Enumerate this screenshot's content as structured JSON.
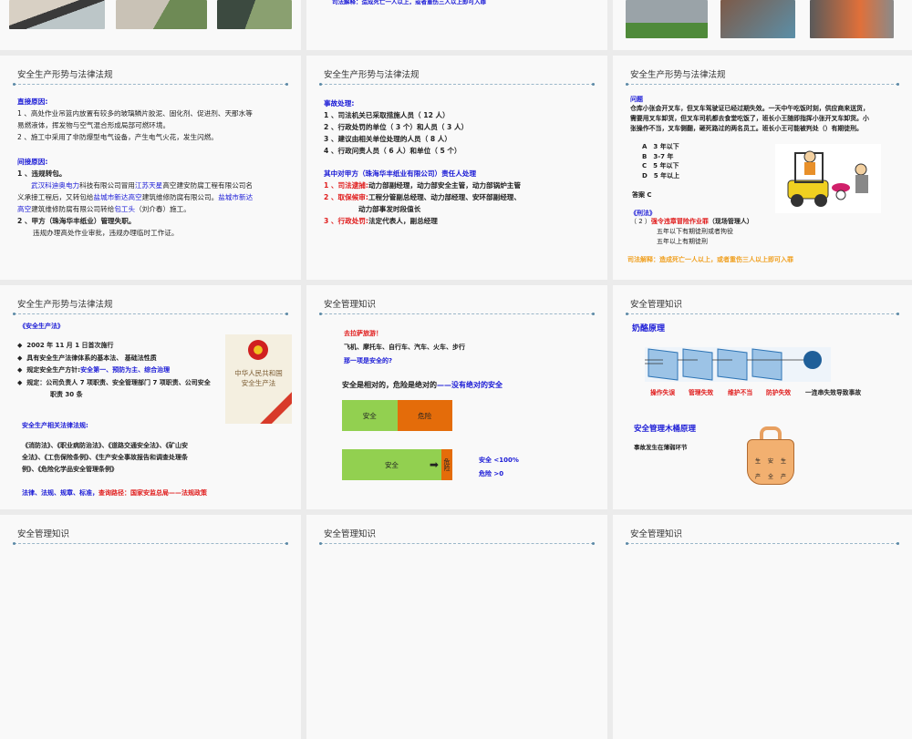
{
  "slide_title_law": "安全生产形势与法律法规",
  "slide_title_mgmt": "安全管理知识",
  "top_row": {
    "middle_text": "司法解释：造成死亡一人以上，或者重伤三人以上即可入罪"
  },
  "slide_direct": {
    "h1": "直接原因:",
    "l1": "1 、高处作业吊篮内放置有较多的玻璃鳞片胶泥、固化剂、促进剂、天那水等",
    "l2": "易燃液体，挥发物与空气混合形成局部可燃环境。",
    "l3": "2 、施工中采用了非防爆型电气设备，产生电气火花，发生闪燃。",
    "h2": "间接原因:",
    "p1": "1 、违规转包。",
    "p1a": [
      "武汉科迪奥电力",
      "科技有限公司冒用",
      "江苏天星",
      "高空建安防腐工程有限公司名"
    ],
    "p1b": [
      "义承接工程后，又转包给",
      "盐城市新达高空",
      "建筑维修防腐有限公司。",
      "盐城市新达"
    ],
    "p1c": [
      "高空",
      "建筑维修防腐有限公司转给",
      "包工头",
      "（刘介春）施工。"
    ],
    "p2": "2 、甲方（珠海华丰纸业）管理失职。",
    "p2a": "违规办理高处作业审批，违规办理临时工作证。"
  },
  "slide_handling": {
    "h1": "事故处理:",
    "items": [
      "1 、司法机关已采取措施人员（ 12 人）",
      "2 、行政处罚的单位（ 3 个）和人员（ 3 人）",
      "3 、建议由相关单位处理的人员（ 8 人）",
      "4 、行政问责人员（ 6 人）和单位（ 5 个）"
    ],
    "h2": "其中对甲方（珠海华丰纸业有限公司）责任人处理",
    "r1": {
      "label": "1 、司法逮捕:",
      "text": "动力部副经理，动力部安全主管，动力部锅炉主管"
    },
    "r2": {
      "label": "2 、取保候审:",
      "text": "工程分管副总经理、动力部经理、安环部副经理、",
      "text2": "动力部事发时段值长"
    },
    "r3": {
      "label": "3 、行政处罚:",
      "text": "法定代表人，副总经理"
    }
  },
  "slide_question": {
    "h": "问题",
    "q": [
      "仓库小张会开叉车，但叉车驾驶证已经过期失效。一天中午吃饭时刻，供应商来送货，",
      "需要用叉车卸货，但叉车司机都去食堂吃饭了，班长小王随即指挥小张开叉车卸货。小",
      "张操作不当，叉车侧翻，砸死路过的两名员工。班长小王可能被判处（）有期徒刑。"
    ],
    "options": [
      "A　3 年以下",
      "B　3-7 年",
      "C　5 年以下",
      "D　5 年以上"
    ],
    "answer": "答案 C",
    "law": "《刑法》",
    "crime_prefix": "（ 2 ）",
    "crime": "强令违章冒险作业罪",
    "crime_suffix": "（现场管理人）",
    "s1": "五年以下有期徒刑或者拘役",
    "s2": "五年以上有期徒刑",
    "note": "司法解释：造成死亡一人以上，或者重伤三人以上即可入罪"
  },
  "slide_safety_law": {
    "h": "《安全生产法》",
    "bullets": [
      "2002 年 11 月 1 日首次施行",
      "具有安全生产法律体系的基本法、 基础法性质"
    ],
    "b3_label": "规定安全生产方针:",
    "b3_blue": "安全第一、预防为主、综合治理",
    "b4": "规定：公司负责人 7 项职责、安全管理部门 7 项职责、公司安全",
    "b4b": "职责 30 条",
    "book_title_1": "中华人民共和国",
    "book_title_2": "安全生产法",
    "h2": "安全生产相关法律法规:",
    "laws": [
      "《消防法》、《职业病防治法》、《道路交通安全法》、《矿山安",
      "全法》、《工伤保险条例》、《生产安全事故报告和调查处理条",
      "例》、《危险化学品安全管理条例》"
    ],
    "footer_blue": "法律、法规、规章、标准，",
    "footer_red": "查询路径：国家安监总局——法规政策"
  },
  "slide_relative": {
    "l1": "去拉萨旅游！",
    "l2": "飞机、摩托车、自行车、汽车、火车、步行",
    "l3": "那一项是安全的?",
    "l4_black": "安全是相对的，危险是绝对的",
    "l4_blue": "——没有绝对的安全",
    "bar1": {
      "safe": "安全",
      "danger": "危险",
      "safe_fraction": 0.5
    },
    "bar2": {
      "safe": "安全",
      "danger": "危险",
      "safe_fraction": 0.9
    },
    "s1": "安全 <100%",
    "s2": "危险 >0"
  },
  "slide_cheese": {
    "h1": "奶酪原理",
    "labels": [
      "操作失误",
      "管理失效",
      "维护不当",
      "防护失效"
    ],
    "summary": "一连串失效导致事故",
    "h2": "安全管理木桶原理",
    "p": "事故发生在薄弱环节",
    "barrel_chars": [
      "生",
      "产",
      "安",
      "全",
      "生",
      "产"
    ]
  },
  "colors": {
    "blue": "#1a1ad6",
    "red": "#e01b1b",
    "green": "#92d050",
    "orange": "#e46c0a"
  }
}
